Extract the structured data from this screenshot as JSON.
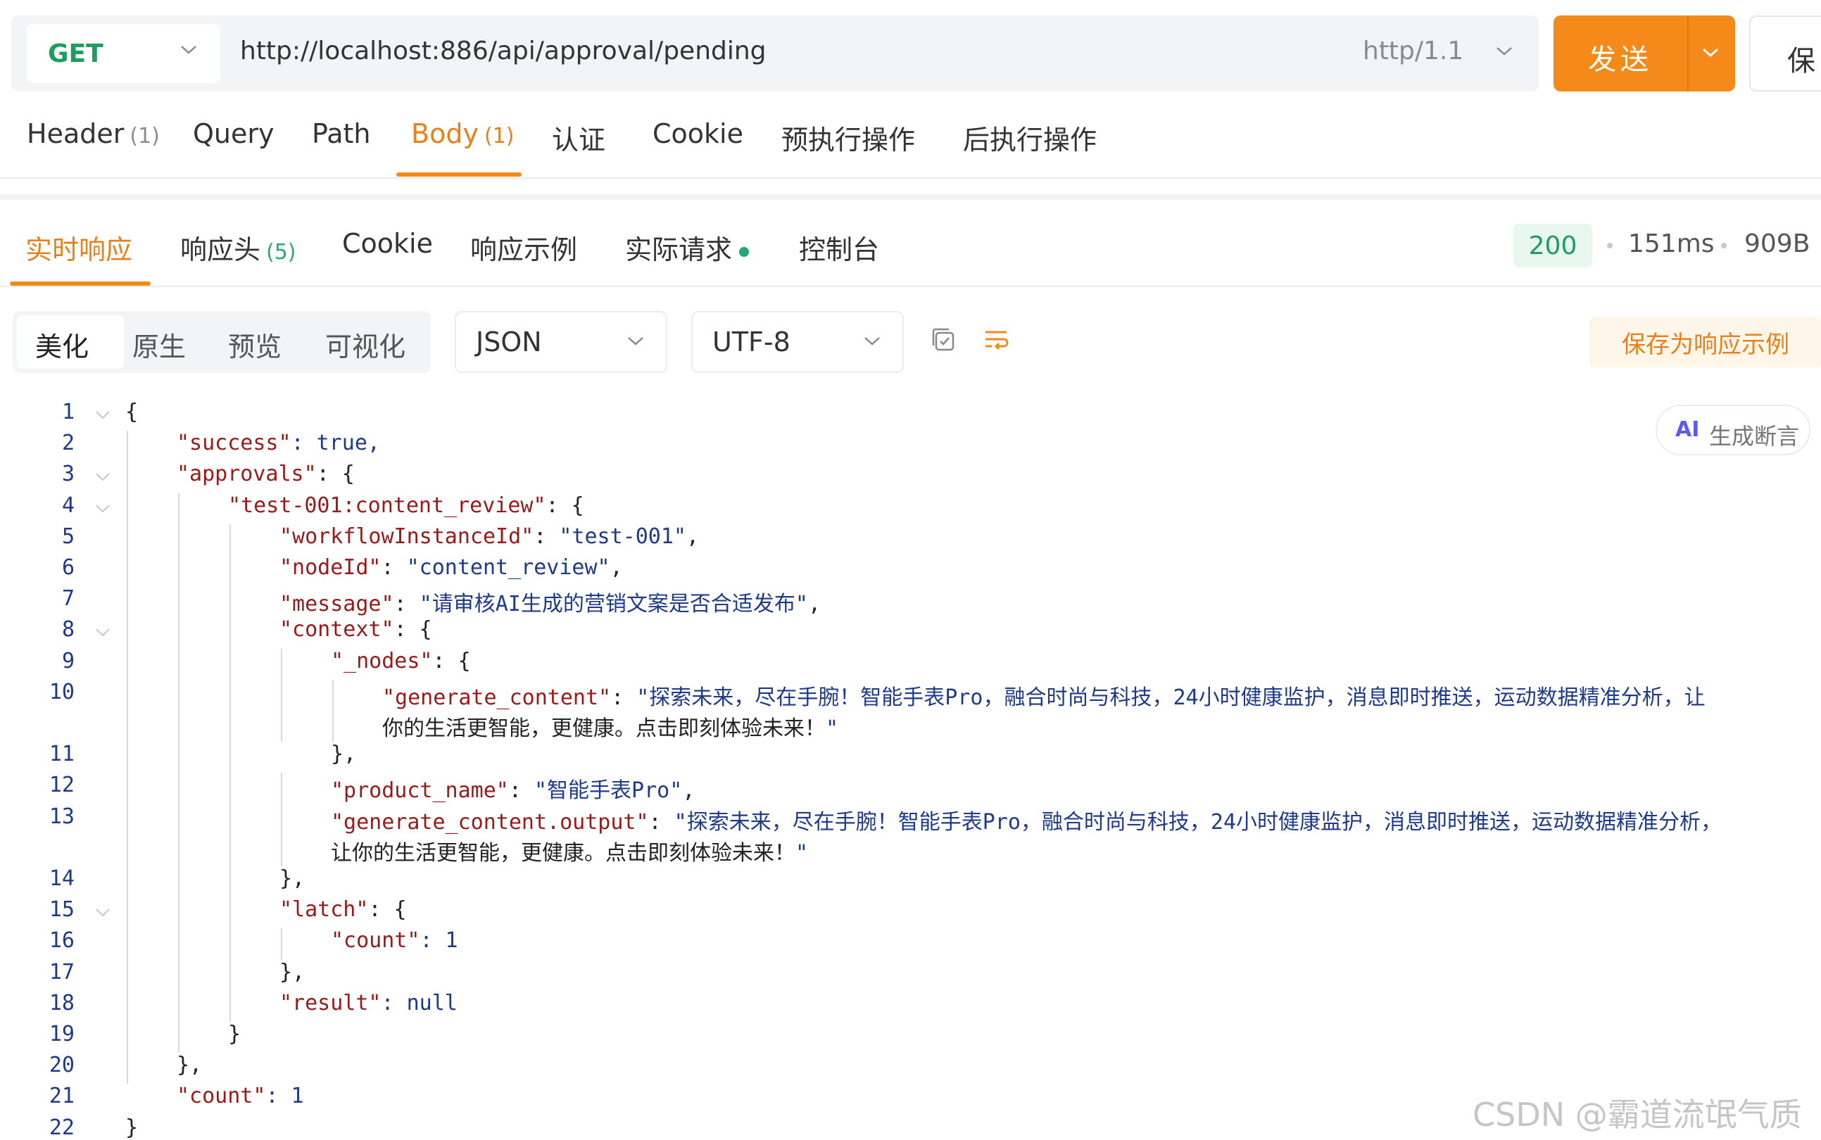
{
  "request": {
    "method": "GET",
    "url": "http://localhost:886/api/approval/pending",
    "protocol": "http/1.1",
    "send_label": "发送",
    "save_label": "保"
  },
  "request_tabs": [
    {
      "label": "Header",
      "count": "(1)"
    },
    {
      "label": "Query",
      "count": ""
    },
    {
      "label": "Path",
      "count": ""
    },
    {
      "label": "Body",
      "count": "(1)",
      "active": true
    },
    {
      "label": "认证",
      "count": ""
    },
    {
      "label": "Cookie",
      "count": ""
    },
    {
      "label": "预执行操作",
      "count": ""
    },
    {
      "label": "后执行操作",
      "count": ""
    }
  ],
  "response_tabs": [
    {
      "label": "实时响应",
      "count": "",
      "active": true
    },
    {
      "label": "响应头",
      "count": "(5)"
    },
    {
      "label": "Cookie",
      "count": ""
    },
    {
      "label": "响应示例",
      "count": ""
    },
    {
      "label": "实际请求",
      "count": "",
      "dot": true
    },
    {
      "label": "控制台",
      "count": ""
    }
  ],
  "response_meta": {
    "status": "200",
    "time": "151ms",
    "size": "909B"
  },
  "view_modes": [
    "美化",
    "原生",
    "预览",
    "可视化"
  ],
  "format": "JSON",
  "encoding": "UTF-8",
  "save_example_label": "保存为响应示例",
  "ai_assert": {
    "badge": "AI",
    "label": "生成断言"
  },
  "code_lines": [
    {
      "n": "1",
      "text": "{"
    },
    {
      "n": "2",
      "text": "\"success\": true,"
    },
    {
      "n": "3",
      "text": "\"approvals\": {"
    },
    {
      "n": "4",
      "text": "\"test-001:content_review\": {"
    },
    {
      "n": "5",
      "text": "\"workflowInstanceId\": \"test-001\","
    },
    {
      "n": "6",
      "text": "\"nodeId\": \"content_review\","
    },
    {
      "n": "7",
      "text": "\"message\": \"请审核AI生成的营销文案是否合适发布\","
    },
    {
      "n": "8",
      "text": "\"context\": {"
    },
    {
      "n": "9",
      "text": "\"_nodes\": {"
    },
    {
      "n": "10",
      "text": "\"generate_content\": \"探索未来，尽在手腕！智能手表Pro，融合时尚与科技，24小时健康监护，消息即时推送，运动数据精准分析，让"
    },
    {
      "n": "",
      "text": "你的生活更智能，更健康。点击即刻体验未来！\""
    },
    {
      "n": "11",
      "text": "},"
    },
    {
      "n": "12",
      "text": "\"product_name\": \"智能手表Pro\","
    },
    {
      "n": "13",
      "text": "\"generate_content.output\": \"探索未来，尽在手腕！智能手表Pro，融合时尚与科技，24小时健康监护，消息即时推送，运动数据精准分析，"
    },
    {
      "n": "",
      "text": "让你的生活更智能，更健康。点击即刻体验未来！\""
    },
    {
      "n": "14",
      "text": "},"
    },
    {
      "n": "15",
      "text": "\"latch\": {"
    },
    {
      "n": "16",
      "text": "\"count\": 1"
    },
    {
      "n": "17",
      "text": "},"
    },
    {
      "n": "18",
      "text": "\"result\": null"
    },
    {
      "n": "19",
      "text": "}"
    },
    {
      "n": "20",
      "text": "},"
    },
    {
      "n": "21",
      "text": "\"count\": 1"
    },
    {
      "n": "22",
      "text": "}"
    }
  ],
  "watermark": "CSDN @霸道流氓气质",
  "colors": {
    "accent": "#f58a1a",
    "status_green": "#1f9d60",
    "json_key": "#9a1a1a",
    "json_value": "#1e3a8a"
  }
}
